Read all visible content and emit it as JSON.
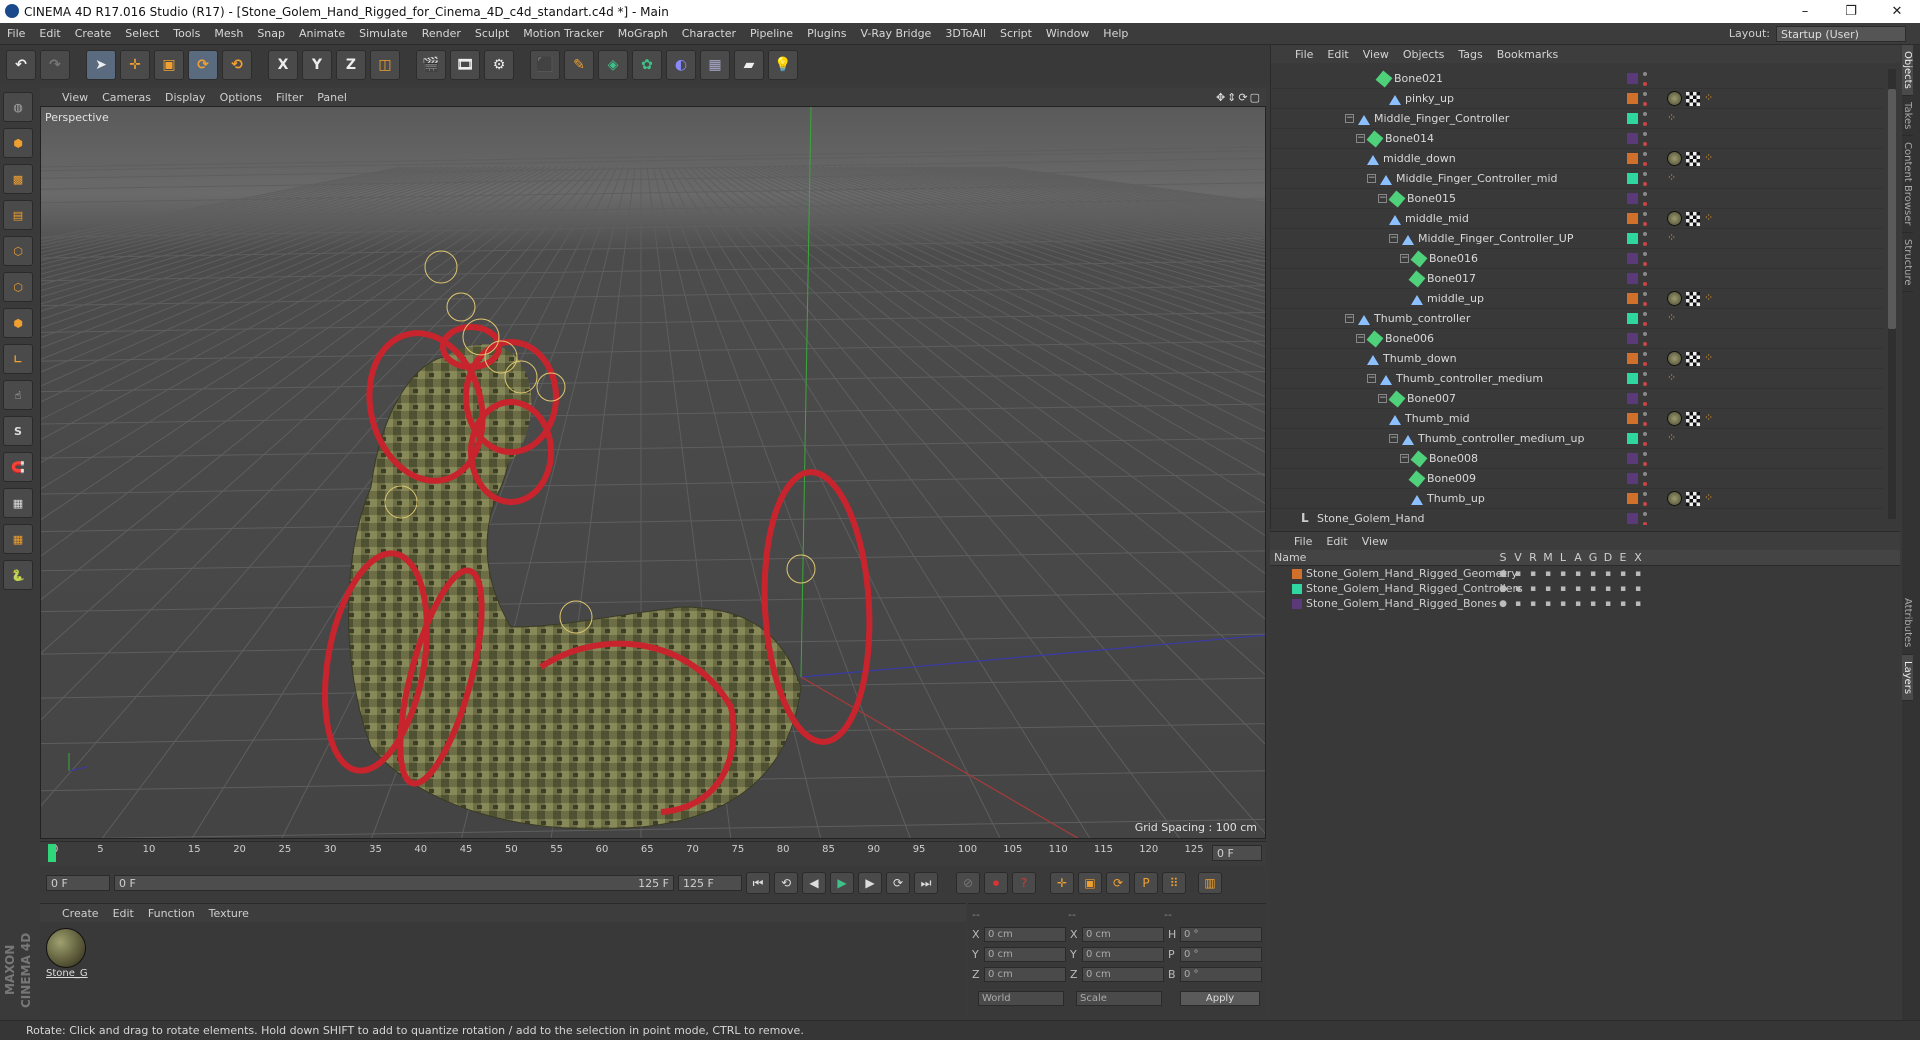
{
  "window": {
    "title": "CINEMA 4D R17.016 Studio (R17) - [Stone_Golem_Hand_Rigged_for_Cinema_4D_c4d_standart.c4d *] - Main",
    "min": "–",
    "max": "❐",
    "close": "✕"
  },
  "menubar": {
    "items": [
      "File",
      "Edit",
      "Create",
      "Select",
      "Tools",
      "Mesh",
      "Snap",
      "Animate",
      "Simulate",
      "Render",
      "Sculpt",
      "Motion Tracker",
      "MoGraph",
      "Character",
      "Pipeline",
      "Plugins",
      "V-Ray Bridge",
      "3DToAll",
      "Script",
      "Window",
      "Help"
    ],
    "layout_label": "Layout:",
    "layout_value": "Startup (User)"
  },
  "toolbar": {
    "x_label": "X",
    "y_label": "Y",
    "z_label": "Z"
  },
  "viewport": {
    "menu": [
      "View",
      "Cameras",
      "Display",
      "Options",
      "Filter",
      "Panel"
    ],
    "nav": "✥⇕⟳▢",
    "label": "Perspective",
    "grid_spacing": "Grid Spacing : 100 cm"
  },
  "timeline": {
    "ticks": [
      "0",
      "5",
      "10",
      "15",
      "20",
      "25",
      "30",
      "35",
      "40",
      "45",
      "50",
      "55",
      "60",
      "65",
      "70",
      "75",
      "80",
      "85",
      "90",
      "95",
      "100",
      "105",
      "110",
      "115",
      "120",
      "125"
    ],
    "current": "0 F"
  },
  "timectrl": {
    "start": "0 F",
    "range_start": "0 F",
    "range_end": "125 F",
    "end": "125 F"
  },
  "materials": {
    "menu": [
      "Create",
      "Edit",
      "Function",
      "Texture"
    ],
    "items": [
      {
        "name": "Stone_G"
      }
    ]
  },
  "coords": {
    "header": [
      "--",
      "--",
      "--"
    ],
    "rows": [
      {
        "a": "X",
        "av": "0 cm",
        "b": "X",
        "bv": "0 cm",
        "c": "H",
        "cv": "0 °"
      },
      {
        "a": "Y",
        "av": "0 cm",
        "b": "Y",
        "bv": "0 cm",
        "c": "P",
        "cv": "0 °"
      },
      {
        "a": "Z",
        "av": "0 cm",
        "b": "Z",
        "bv": "0 cm",
        "c": "B",
        "cv": "0 °"
      }
    ],
    "world": "World",
    "scale": "Scale",
    "apply": "Apply"
  },
  "objects": {
    "menu": [
      "File",
      "Edit",
      "View",
      "Objects",
      "Tags",
      "Bookmarks"
    ],
    "rows": [
      {
        "name": "Bone021",
        "depth": 7,
        "type": "bone",
        "color": "#5a3a78",
        "tags": []
      },
      {
        "name": "pinky_up",
        "depth": 8,
        "type": "joint",
        "color": "#d0702a",
        "tags": [
          "mat",
          "chk",
          "ik"
        ]
      },
      {
        "name": "Middle_Finger_Controller",
        "depth": 4,
        "type": "joint",
        "color": "#2fd6a0",
        "expand": true,
        "tags": [
          "ik"
        ]
      },
      {
        "name": "Bone014",
        "depth": 5,
        "type": "bone",
        "color": "#5a3a78",
        "expand": true,
        "tags": []
      },
      {
        "name": "middle_down",
        "depth": 6,
        "type": "joint",
        "color": "#d0702a",
        "tags": [
          "mat",
          "chk",
          "ik"
        ]
      },
      {
        "name": "Middle_Finger_Controller_mid",
        "depth": 6,
        "type": "joint",
        "color": "#2fd6a0",
        "expand": true,
        "tags": [
          "ik"
        ]
      },
      {
        "name": "Bone015",
        "depth": 7,
        "type": "bone",
        "color": "#5a3a78",
        "expand": true,
        "tags": []
      },
      {
        "name": "middle_mid",
        "depth": 8,
        "type": "joint",
        "color": "#d0702a",
        "tags": [
          "mat",
          "chk",
          "ik"
        ]
      },
      {
        "name": "Middle_Finger_Controller_UP",
        "depth": 8,
        "type": "joint",
        "color": "#2fd6a0",
        "expand": true,
        "tags": [
          "ik"
        ]
      },
      {
        "name": "Bone016",
        "depth": 9,
        "type": "bone",
        "color": "#5a3a78",
        "expand": true,
        "tags": []
      },
      {
        "name": "Bone017",
        "depth": 10,
        "type": "bone",
        "color": "#5a3a78",
        "tags": []
      },
      {
        "name": "middle_up",
        "depth": 10,
        "type": "joint",
        "color": "#d0702a",
        "tags": [
          "mat",
          "chk",
          "ik"
        ]
      },
      {
        "name": "Thumb_controller",
        "depth": 4,
        "type": "joint",
        "color": "#2fd6a0",
        "expand": true,
        "tags": [
          "ik"
        ]
      },
      {
        "name": "Bone006",
        "depth": 5,
        "type": "bone",
        "color": "#5a3a78",
        "expand": true,
        "tags": []
      },
      {
        "name": "Thumb_down",
        "depth": 6,
        "type": "joint",
        "color": "#d0702a",
        "tags": [
          "mat",
          "chk",
          "ik"
        ]
      },
      {
        "name": "Thumb_controller_medium",
        "depth": 6,
        "type": "joint",
        "color": "#2fd6a0",
        "expand": true,
        "tags": [
          "ik"
        ]
      },
      {
        "name": "Bone007",
        "depth": 7,
        "type": "bone",
        "color": "#5a3a78",
        "expand": true,
        "tags": []
      },
      {
        "name": "Thumb_mid",
        "depth": 8,
        "type": "joint",
        "color": "#d0702a",
        "tags": [
          "mat",
          "chk",
          "ik"
        ]
      },
      {
        "name": "Thumb_controller_medium_up",
        "depth": 8,
        "type": "joint",
        "color": "#2fd6a0",
        "expand": true,
        "tags": [
          "ik"
        ]
      },
      {
        "name": "Bone008",
        "depth": 9,
        "type": "bone",
        "color": "#5a3a78",
        "expand": true,
        "tags": []
      },
      {
        "name": "Bone009",
        "depth": 10,
        "type": "bone",
        "color": "#5a3a78",
        "tags": []
      },
      {
        "name": "Thumb_up",
        "depth": 10,
        "type": "joint",
        "color": "#d0702a",
        "tags": [
          "mat",
          "chk",
          "ik"
        ]
      },
      {
        "name": "Stone_Golem_Hand",
        "depth": 0,
        "type": "null",
        "color": "#5a3a78",
        "tags": []
      }
    ]
  },
  "side_tabs": [
    "Objects",
    "Takes",
    "Content Browser",
    "Structure",
    "Attributes",
    "Layers"
  ],
  "layers": {
    "menu": [
      "File",
      "Edit",
      "View"
    ],
    "columns": [
      "Name",
      "S",
      "V",
      "R",
      "M",
      "L",
      "A",
      "G",
      "D",
      "E",
      "X"
    ],
    "rows": [
      {
        "name": "Stone_Golem_Hand_Rigged_Geometry",
        "color": "#d0702a"
      },
      {
        "name": "Stone_Golem_Hand_Rigged_Controllers",
        "color": "#2fd6a0"
      },
      {
        "name": "Stone_Golem_Hand_Rigged_Bones",
        "color": "#5a3a78"
      }
    ]
  },
  "status": "Rotate: Click and drag to rotate elements. Hold down SHIFT to add to quantize rotation / add to the selection in point mode, CTRL to remove.",
  "branding": "MAXON CINEMA 4D"
}
